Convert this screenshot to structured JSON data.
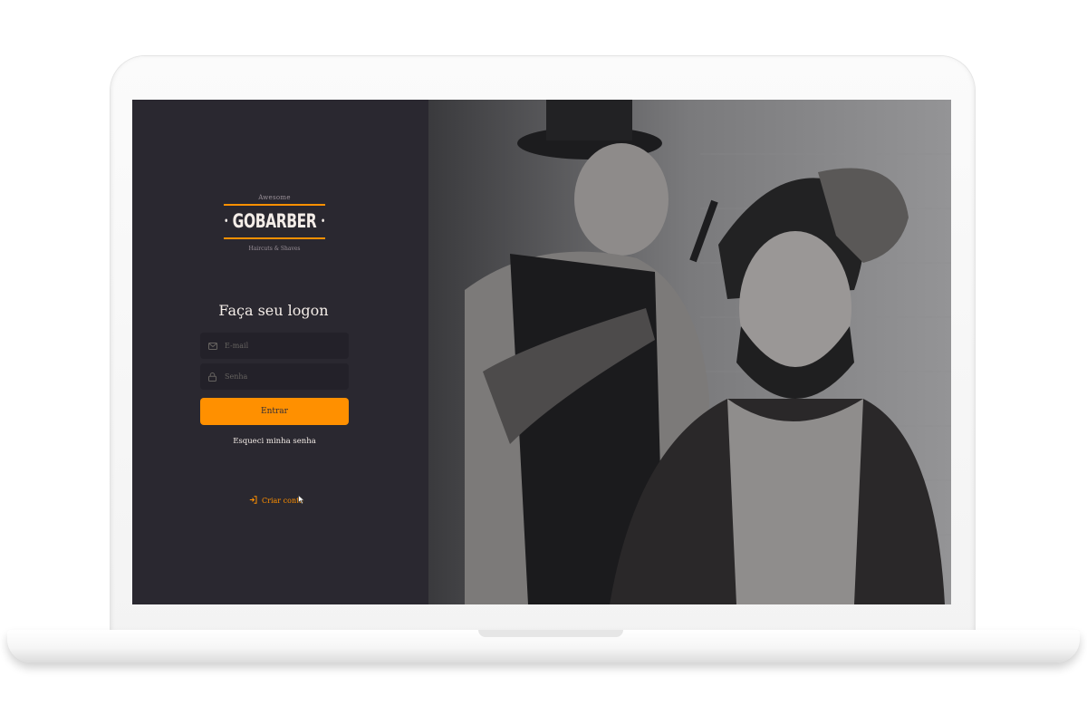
{
  "logo": {
    "tagline_top": "Awesome",
    "brand": "GOBARBER",
    "tagline_bottom": "Haircuts & Shaves"
  },
  "login": {
    "title": "Faça seu logon",
    "email_placeholder": "E-mail",
    "password_placeholder": "Senha",
    "submit_label": "Entrar",
    "forgot_label": "Esqueci minha senha",
    "create_account_label": "Criar conta"
  },
  "colors": {
    "accent": "#ff9000",
    "panel_bg": "#2a2830",
    "input_bg": "#232129",
    "text": "#f4ede8",
    "placeholder": "#666360"
  },
  "icons": {
    "email": "mail-icon",
    "password": "lock-icon",
    "create_account": "log-in-icon",
    "cursor": "mouse-pointer-icon"
  }
}
